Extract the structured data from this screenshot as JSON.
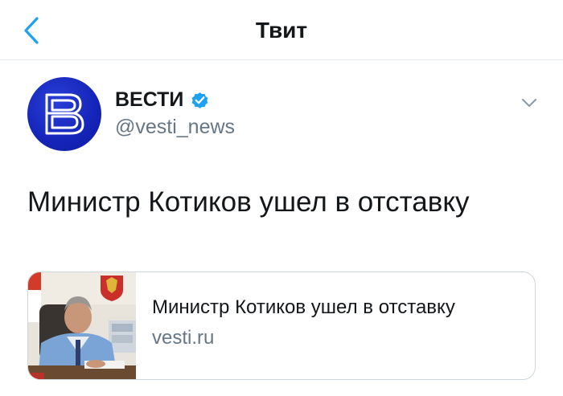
{
  "header": {
    "title": "Твит",
    "back_icon": "chevron-left-icon",
    "accent_color": "#1da1f2"
  },
  "tweet": {
    "author": {
      "name": "ВЕСТИ",
      "handle": "@vesti_news",
      "verified": true,
      "avatar_color": "#1424b8"
    },
    "text": "Министр Котиков ушел в отставку",
    "card": {
      "title": "Министр Котиков ушел в отставку",
      "domain": "vesti.ru"
    }
  }
}
